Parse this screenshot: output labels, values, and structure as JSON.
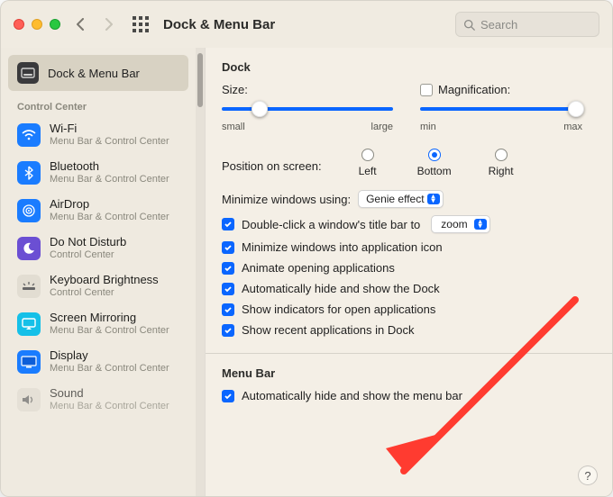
{
  "window": {
    "title": "Dock & Menu Bar"
  },
  "search": {
    "placeholder": "Search"
  },
  "sidebar": {
    "selected_label": "Dock & Menu Bar",
    "section_header": "Control Center",
    "items": [
      {
        "name": "Wi-Fi",
        "sub": "Menu Bar & Control Center"
      },
      {
        "name": "Bluetooth",
        "sub": "Menu Bar & Control Center"
      },
      {
        "name": "AirDrop",
        "sub": "Menu Bar & Control Center"
      },
      {
        "name": "Do Not Disturb",
        "sub": "Control Center"
      },
      {
        "name": "Keyboard Brightness",
        "sub": "Control Center"
      },
      {
        "name": "Screen Mirroring",
        "sub": "Menu Bar & Control Center"
      },
      {
        "name": "Display",
        "sub": "Menu Bar & Control Center"
      },
      {
        "name": "Sound",
        "sub": "Menu Bar & Control Center"
      }
    ]
  },
  "dock": {
    "title": "Dock",
    "size_label": "Size:",
    "size_small": "small",
    "size_large": "large",
    "size_value": 0.22,
    "mag_enabled": false,
    "mag_label": "Magnification:",
    "mag_min": "min",
    "mag_max": "max",
    "mag_value": 1.0,
    "position_label": "Position on screen:",
    "positions": {
      "left": "Left",
      "bottom": "Bottom",
      "right": "Right"
    },
    "position_selected": "bottom",
    "minimize_label": "Minimize windows using:",
    "minimize_effect": "Genie effect",
    "dc_label": "Double-click a window's title bar to",
    "dc_action": "zoom",
    "opts": {
      "min_into_icon": "Minimize windows into application icon",
      "animate": "Animate opening applications",
      "autohide_dock": "Automatically hide and show the Dock",
      "indicators": "Show indicators for open applications",
      "recent": "Show recent applications in Dock"
    }
  },
  "menubar": {
    "title": "Menu Bar",
    "autohide": "Automatically hide and show the menu bar"
  },
  "help": "?"
}
